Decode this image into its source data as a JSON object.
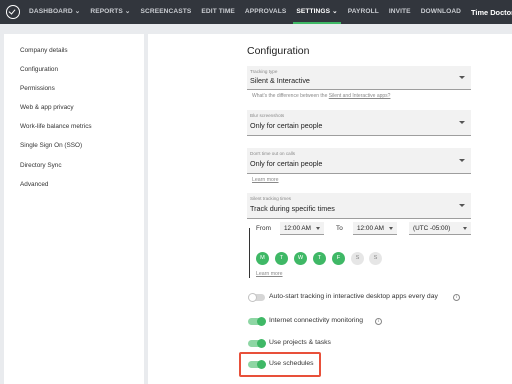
{
  "nav": {
    "items": [
      {
        "label": "DASHBOARD ⌄"
      },
      {
        "label": "REPORTS ⌄"
      },
      {
        "label": "SCREENCASTS"
      },
      {
        "label": "EDIT TIME"
      },
      {
        "label": "APPROVALS"
      },
      {
        "label": "SETTINGS ⌄"
      },
      {
        "label": "PAYROLL"
      },
      {
        "label": "INVITE"
      },
      {
        "label": "DOWNLOAD"
      }
    ],
    "active_index": 5,
    "brand": "Time Doctor"
  },
  "sidebar": {
    "items": [
      {
        "label": "Company details"
      },
      {
        "label": "Configuration"
      },
      {
        "label": "Permissions"
      },
      {
        "label": "Web & app privacy"
      },
      {
        "label": "Work-life balance metrics"
      },
      {
        "label": "Single Sign On (SSO)"
      },
      {
        "label": "Directory Sync"
      },
      {
        "label": "Advanced"
      }
    ]
  },
  "main": {
    "title": "Configuration",
    "tracking_type": {
      "label": "Tracking type",
      "value": "Silent & Interactive",
      "helper_prefix": "What's the difference between the ",
      "helper_link": "Silent and Interactive apps?"
    },
    "blur_screenshots": {
      "label": "Blur screenshots",
      "value": "Only for certain people"
    },
    "dont_time_out": {
      "label": "Don't time out on calls",
      "value": "Only for certain people",
      "link": "Learn more"
    },
    "silent_tracking_times": {
      "label": "Silent tracking times",
      "value": "Track during specific times",
      "from_label": "From",
      "from_value": "12:00 AM",
      "to_label": "To",
      "to_value": "12:00 AM",
      "timezone": "(UTC -05:00)",
      "days": [
        {
          "letter": "M",
          "on": true
        },
        {
          "letter": "T",
          "on": true
        },
        {
          "letter": "W",
          "on": true
        },
        {
          "letter": "T",
          "on": true
        },
        {
          "letter": "F",
          "on": true
        },
        {
          "letter": "S",
          "on": false
        },
        {
          "letter": "S",
          "on": false
        }
      ],
      "link": "Learn more"
    },
    "toggles": [
      {
        "label": "Auto-start tracking in interactive desktop apps every day",
        "on": false,
        "info": true
      },
      {
        "label": "Internet connectivity monitoring",
        "on": true,
        "info": true
      },
      {
        "label": "Use projects & tasks",
        "on": true,
        "info": false
      },
      {
        "label": "Use schedules",
        "on": true,
        "info": false
      }
    ],
    "info_glyph": "i"
  },
  "colors": {
    "nav_bg": "#32363d",
    "accent_green": "#3fb866",
    "highlight_red": "#e8503a"
  }
}
